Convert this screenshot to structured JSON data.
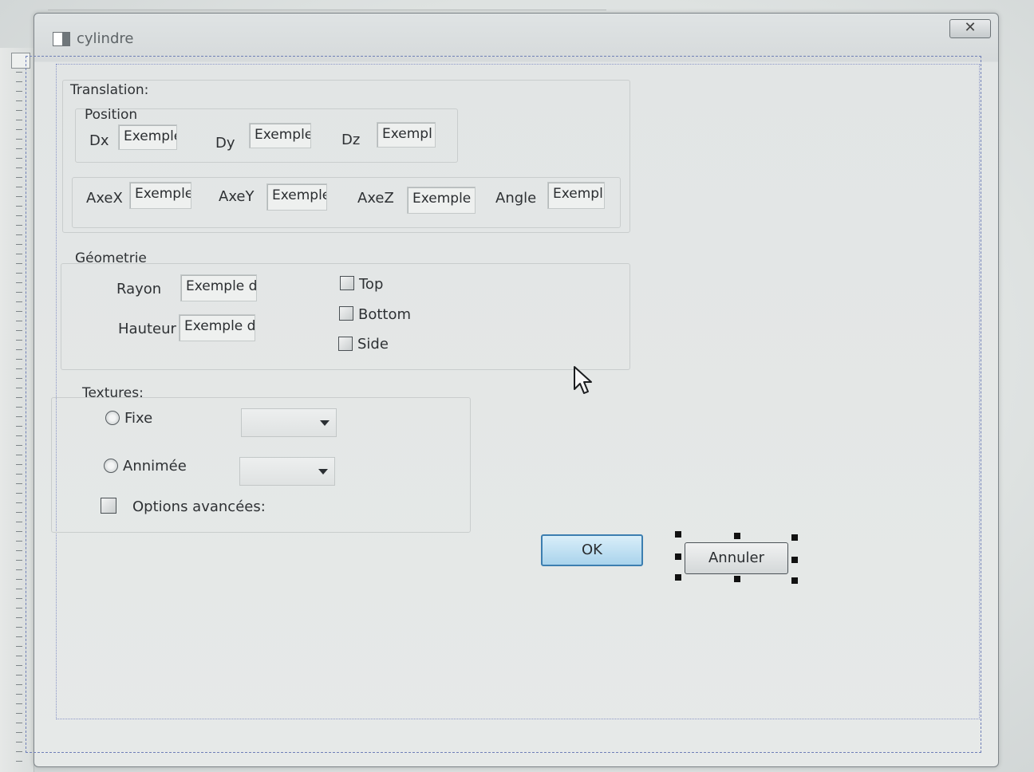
{
  "window": {
    "title": "cylindre",
    "close_glyph": "✕"
  },
  "translation": {
    "label": "Translation:",
    "position_label": "Position",
    "fields": [
      {
        "label": "Dx",
        "value": "Exemple"
      },
      {
        "label": "Dy",
        "value": "Exemple"
      },
      {
        "label": "Dz",
        "value": "Exempl"
      }
    ],
    "axes": [
      {
        "label": "AxeX",
        "value": "Exemple"
      },
      {
        "label": "AxeY",
        "value": "Exemple"
      },
      {
        "label": "AxeZ",
        "value": "Exemple d"
      },
      {
        "label": "Angle",
        "value": "Exempl"
      }
    ]
  },
  "geometrie": {
    "label": "Géometrie",
    "rayon_label": "Rayon",
    "rayon_value": "Exemple de",
    "hauteur_label": "Hauteur",
    "hauteur_value": "Exemple de",
    "checkboxes": [
      {
        "label": "Top",
        "checked": false
      },
      {
        "label": "Bottom",
        "checked": false
      },
      {
        "label": "Side",
        "checked": false
      }
    ]
  },
  "textures": {
    "label": "Textures:",
    "fixe_label": "Fixe",
    "annimee_label": "Annimée",
    "options_label": "Options avancées:"
  },
  "buttons": {
    "ok": "OK",
    "cancel": "Annuler"
  }
}
